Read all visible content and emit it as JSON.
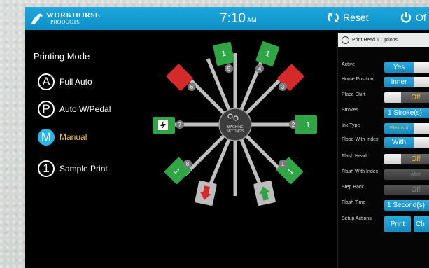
{
  "header": {
    "brand_line1": "WORKHORSE",
    "brand_line2": "PRODUCTS",
    "time": "7:10",
    "ampm": "AM",
    "reset_label": "Reset",
    "power_label": "Of"
  },
  "printing_mode": {
    "title": "Printing Mode",
    "modes": [
      {
        "glyph": "A",
        "label": "Full Auto",
        "active": false
      },
      {
        "glyph": "P",
        "label": "Auto W/Pedal",
        "active": false
      },
      {
        "glyph": "M",
        "label": "Manual",
        "active": true
      },
      {
        "glyph": "1",
        "label": "Sample Print",
        "active": false
      }
    ]
  },
  "machine": {
    "center_label_line1": "MACHINE",
    "center_label_line2": "SETTINGS",
    "heads": [
      {
        "num": "1",
        "pad": "1",
        "state": "green"
      },
      {
        "num": "2",
        "pad": "1",
        "state": "green"
      },
      {
        "num": "3",
        "pad": "",
        "state": "red"
      },
      {
        "num": "4",
        "pad": "1",
        "state": "green"
      },
      {
        "num": "5",
        "pad": "1",
        "state": "green"
      },
      {
        "num": "6",
        "pad": "",
        "state": "red"
      },
      {
        "num": "7",
        "pad": "",
        "state": "flash"
      },
      {
        "num": "8",
        "pad": "1",
        "state": "green"
      },
      {
        "num": "",
        "pad": "",
        "state": "unload"
      },
      {
        "num": "",
        "pad": "",
        "state": "load"
      }
    ]
  },
  "options": {
    "title": "Print Head 1 Options",
    "rows": {
      "active": {
        "label": "Active",
        "value": "Yes"
      },
      "home_position": {
        "label": "Home Position",
        "value": "Inner"
      },
      "place_shirt": {
        "label": "Place Shirt",
        "value": "Off"
      },
      "strokes": {
        "label": "Strokes",
        "value": "1 Stroke(s)"
      },
      "ink_type": {
        "label": "Ink Type",
        "value": "Plastisol"
      },
      "flood_with_index": {
        "label": "Flood With Index",
        "value": "With"
      },
      "flash_head": {
        "label": "Flash Head",
        "value": "Off"
      },
      "flash_with_index": {
        "label": "Flash With Index",
        "value": "After"
      },
      "step_back": {
        "label": "Step Back",
        "value": "Off"
      },
      "flash_time": {
        "label": "Flash Time",
        "value": "1 Second(s)"
      },
      "setup_actions": {
        "label": "Setup Actions",
        "print": "Print",
        "other": "Ch"
      }
    }
  },
  "colors": {
    "accent": "#1da7dc",
    "green_pad": "#2fa545",
    "red_pad": "#d42a2a",
    "active_mode_text": "#f2c230"
  }
}
